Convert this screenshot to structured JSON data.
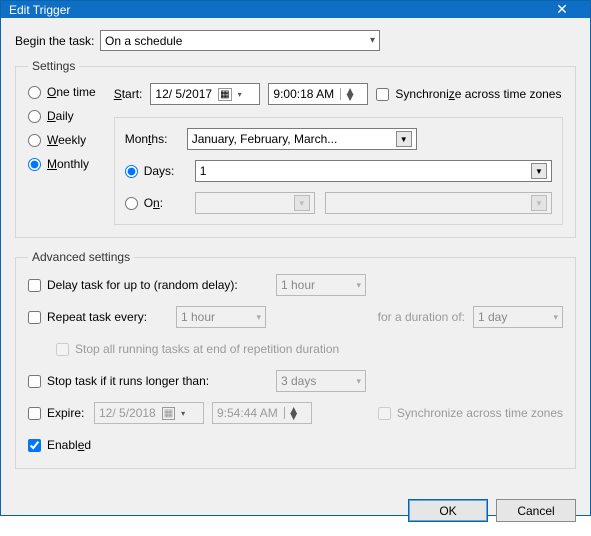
{
  "window": {
    "title": "Edit Trigger"
  },
  "begin_task": {
    "label": "Begin the task:",
    "value": "On a schedule"
  },
  "settings": {
    "legend": "Settings",
    "freq": {
      "one_time": "One time",
      "daily": "Daily",
      "weekly": "Weekly",
      "monthly": "Monthly",
      "selected": "monthly"
    },
    "start_label": "Start:",
    "start_date": "12/  5/2017",
    "start_time": "9:00:18 AM",
    "sync_label": "Synchronize across time zones",
    "monthly": {
      "months_label": "Months:",
      "months_value": "January, February, March...",
      "days_label": "Days:",
      "days_value": "1",
      "on_label": "On:",
      "on_value1": "",
      "on_value2": "",
      "days_selected": true
    }
  },
  "advanced": {
    "legend": "Advanced settings",
    "delay_label": "Delay task for up to (random delay):",
    "delay_value": "1 hour",
    "repeat_label": "Repeat task every:",
    "repeat_value": "1 hour",
    "duration_label": "for a duration of:",
    "duration_value": "1 day",
    "stop_all_label": "Stop all running tasks at end of repetition duration",
    "stop_longer_label": "Stop task if it runs longer than:",
    "stop_longer_value": "3 days",
    "expire_label": "Expire:",
    "expire_date": "12/  5/2018",
    "expire_time": "9:54:44 AM",
    "sync2_label": "Synchronize across time zones",
    "enabled_label": "Enabled"
  },
  "buttons": {
    "ok": "OK",
    "cancel": "Cancel"
  }
}
